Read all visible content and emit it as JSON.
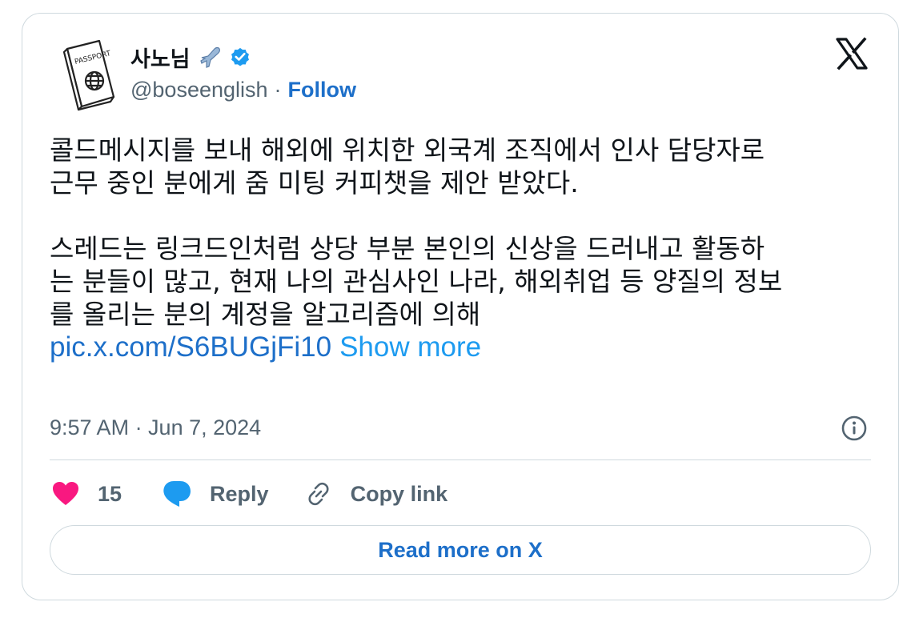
{
  "author": {
    "display_name": "사노님",
    "emoji_icon": "airplane-icon",
    "handle": "@boseenglish",
    "separator": "·",
    "follow_label": "Follow",
    "avatar_icon": "passport-icon",
    "avatar_text": "PASSPORT"
  },
  "tweet": {
    "paragraph1_line1": "콜드메시지를 보내 해외에 위치한 외국계 조직에서 인사 담당자로",
    "paragraph1_line2": "근무 중인 분에게 줌 미팅 커피챗을 제안 받았다.",
    "paragraph2_line1": "스레드는 링크드인처럼 상당 부분 본인의 신상을 드러내고 활동하",
    "paragraph2_line2": "는 분들이 많고, 현재 나의 관심사인 나라, 해외취업 등 양질의 정보",
    "paragraph2_line3": "를 올리는 분의 계정을 알고리즘에 의해",
    "pic_link": "pic.x.com/S6BUGjFi10",
    "show_more": "Show more"
  },
  "meta": {
    "timestamp": "9:57 AM · Jun 7, 2024"
  },
  "actions": {
    "like_count": "15",
    "reply_label": "Reply",
    "copy_label": "Copy link"
  },
  "footer": {
    "read_more": "Read more on X"
  },
  "colors": {
    "link_blue": "#1d6fc9",
    "show_more_blue": "#1d9bf0",
    "like_pink": "#f91880",
    "reply_blue": "#1d9bf0",
    "text_gray": "#536471",
    "border": "#cfd9de",
    "verified_blue": "#1d9bf0"
  }
}
